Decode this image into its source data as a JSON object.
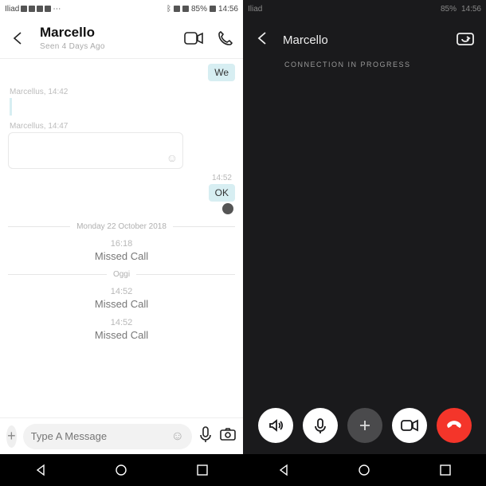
{
  "left": {
    "status": {
      "carrier": "Iliad",
      "battery": "85%",
      "time": "14:56"
    },
    "header": {
      "name": "Marcello",
      "seen": "Seen 4 Days Ago"
    },
    "messages": {
      "out1": "We",
      "in1_meta": "Marcellus, 14:42",
      "in2_meta": "Marcellus, 14:47",
      "time_ok": "14:52",
      "ok": "OK",
      "date_divider": "Monday 22 October 2018",
      "today_divider": "Oggi",
      "missed1_time": "16:18",
      "missed1_text": "Missed Call",
      "missed2_time": "14:52",
      "missed2_text": "Missed Call",
      "missed3_time": "14:52",
      "missed3_text": "Missed Call"
    },
    "compose": {
      "placeholder": "Type A Message"
    }
  },
  "right": {
    "status": {
      "carrier": "Iliad",
      "battery": "85%",
      "time": "14:56"
    },
    "call": {
      "name": "Marcello",
      "status": "CONNECTION IN PROGRESS"
    }
  },
  "icons": {
    "video": "video-icon",
    "phone": "phone-icon",
    "speaker": "speaker-icon",
    "mic": "mic-icon",
    "plus": "plus-icon",
    "hangup": "hangup-icon",
    "camera_flip": "camera-flip-icon"
  }
}
